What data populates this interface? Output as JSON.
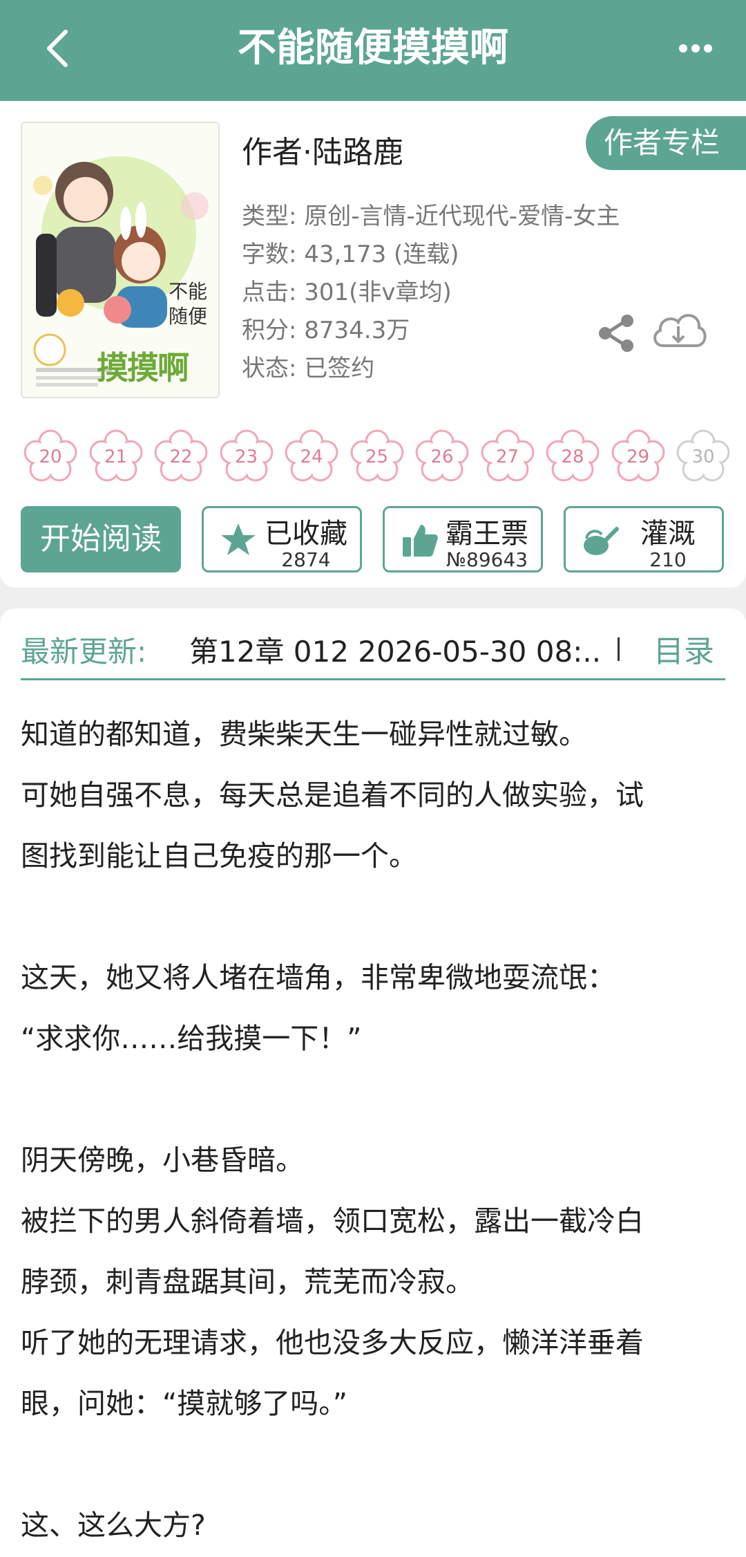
{
  "header": {
    "title": "不能随便摸摸啊"
  },
  "cover": {
    "line1": "不能",
    "line2": "随便",
    "big": "摸摸啊"
  },
  "book": {
    "author": "作者·陆路鹿",
    "author_column": "作者专栏",
    "meta": [
      "类型: 原创-言情-近代现代-爱情-女主",
      "字数: 43,173 (连载)",
      "点击: 301(非v章均)",
      "积分: 8734.3万",
      "状态: 已签约"
    ]
  },
  "flowers": [
    "20",
    "21",
    "22",
    "23",
    "24",
    "25",
    "26",
    "27",
    "28",
    "29",
    "30"
  ],
  "actions": {
    "read": "开始阅读",
    "favorite": {
      "label": "已收藏",
      "count": "2874"
    },
    "ticket": {
      "label": "霸王票",
      "count": "№89643"
    },
    "water": {
      "label": "灌溉",
      "count": "210"
    }
  },
  "latest": {
    "label": "最新更新:",
    "chapter": "第12章  012  2026-05-30 08:..",
    "toc": "目录"
  },
  "content": [
    "知道的都知道，费柴柴天生一碰异性就过敏。",
    "可她自强不息，每天总是追着不同的人做实验，试",
    "图找到能让自己免疫的那一个。",
    "",
    "这天，她又将人堵在墙角，非常卑微地耍流氓：",
    "“求求你……给我摸一下！”",
    "",
    "阴天傍晚，小巷昏暗。",
    "被拦下的男人斜倚着墙，领口宽松，露出一截冷白",
    "脖颈，刺青盘踞其间，荒芜而冷寂。",
    "听了她的无理请求，他也没多大反应，懒洋洋垂着",
    "眼，问她：“摸就够了吗。”",
    "",
    "这、这么大方?"
  ],
  "colors": {
    "accent": "#5da593",
    "flower_pink": "#f3a5b6",
    "flower_gray": "#cfcfcf"
  }
}
